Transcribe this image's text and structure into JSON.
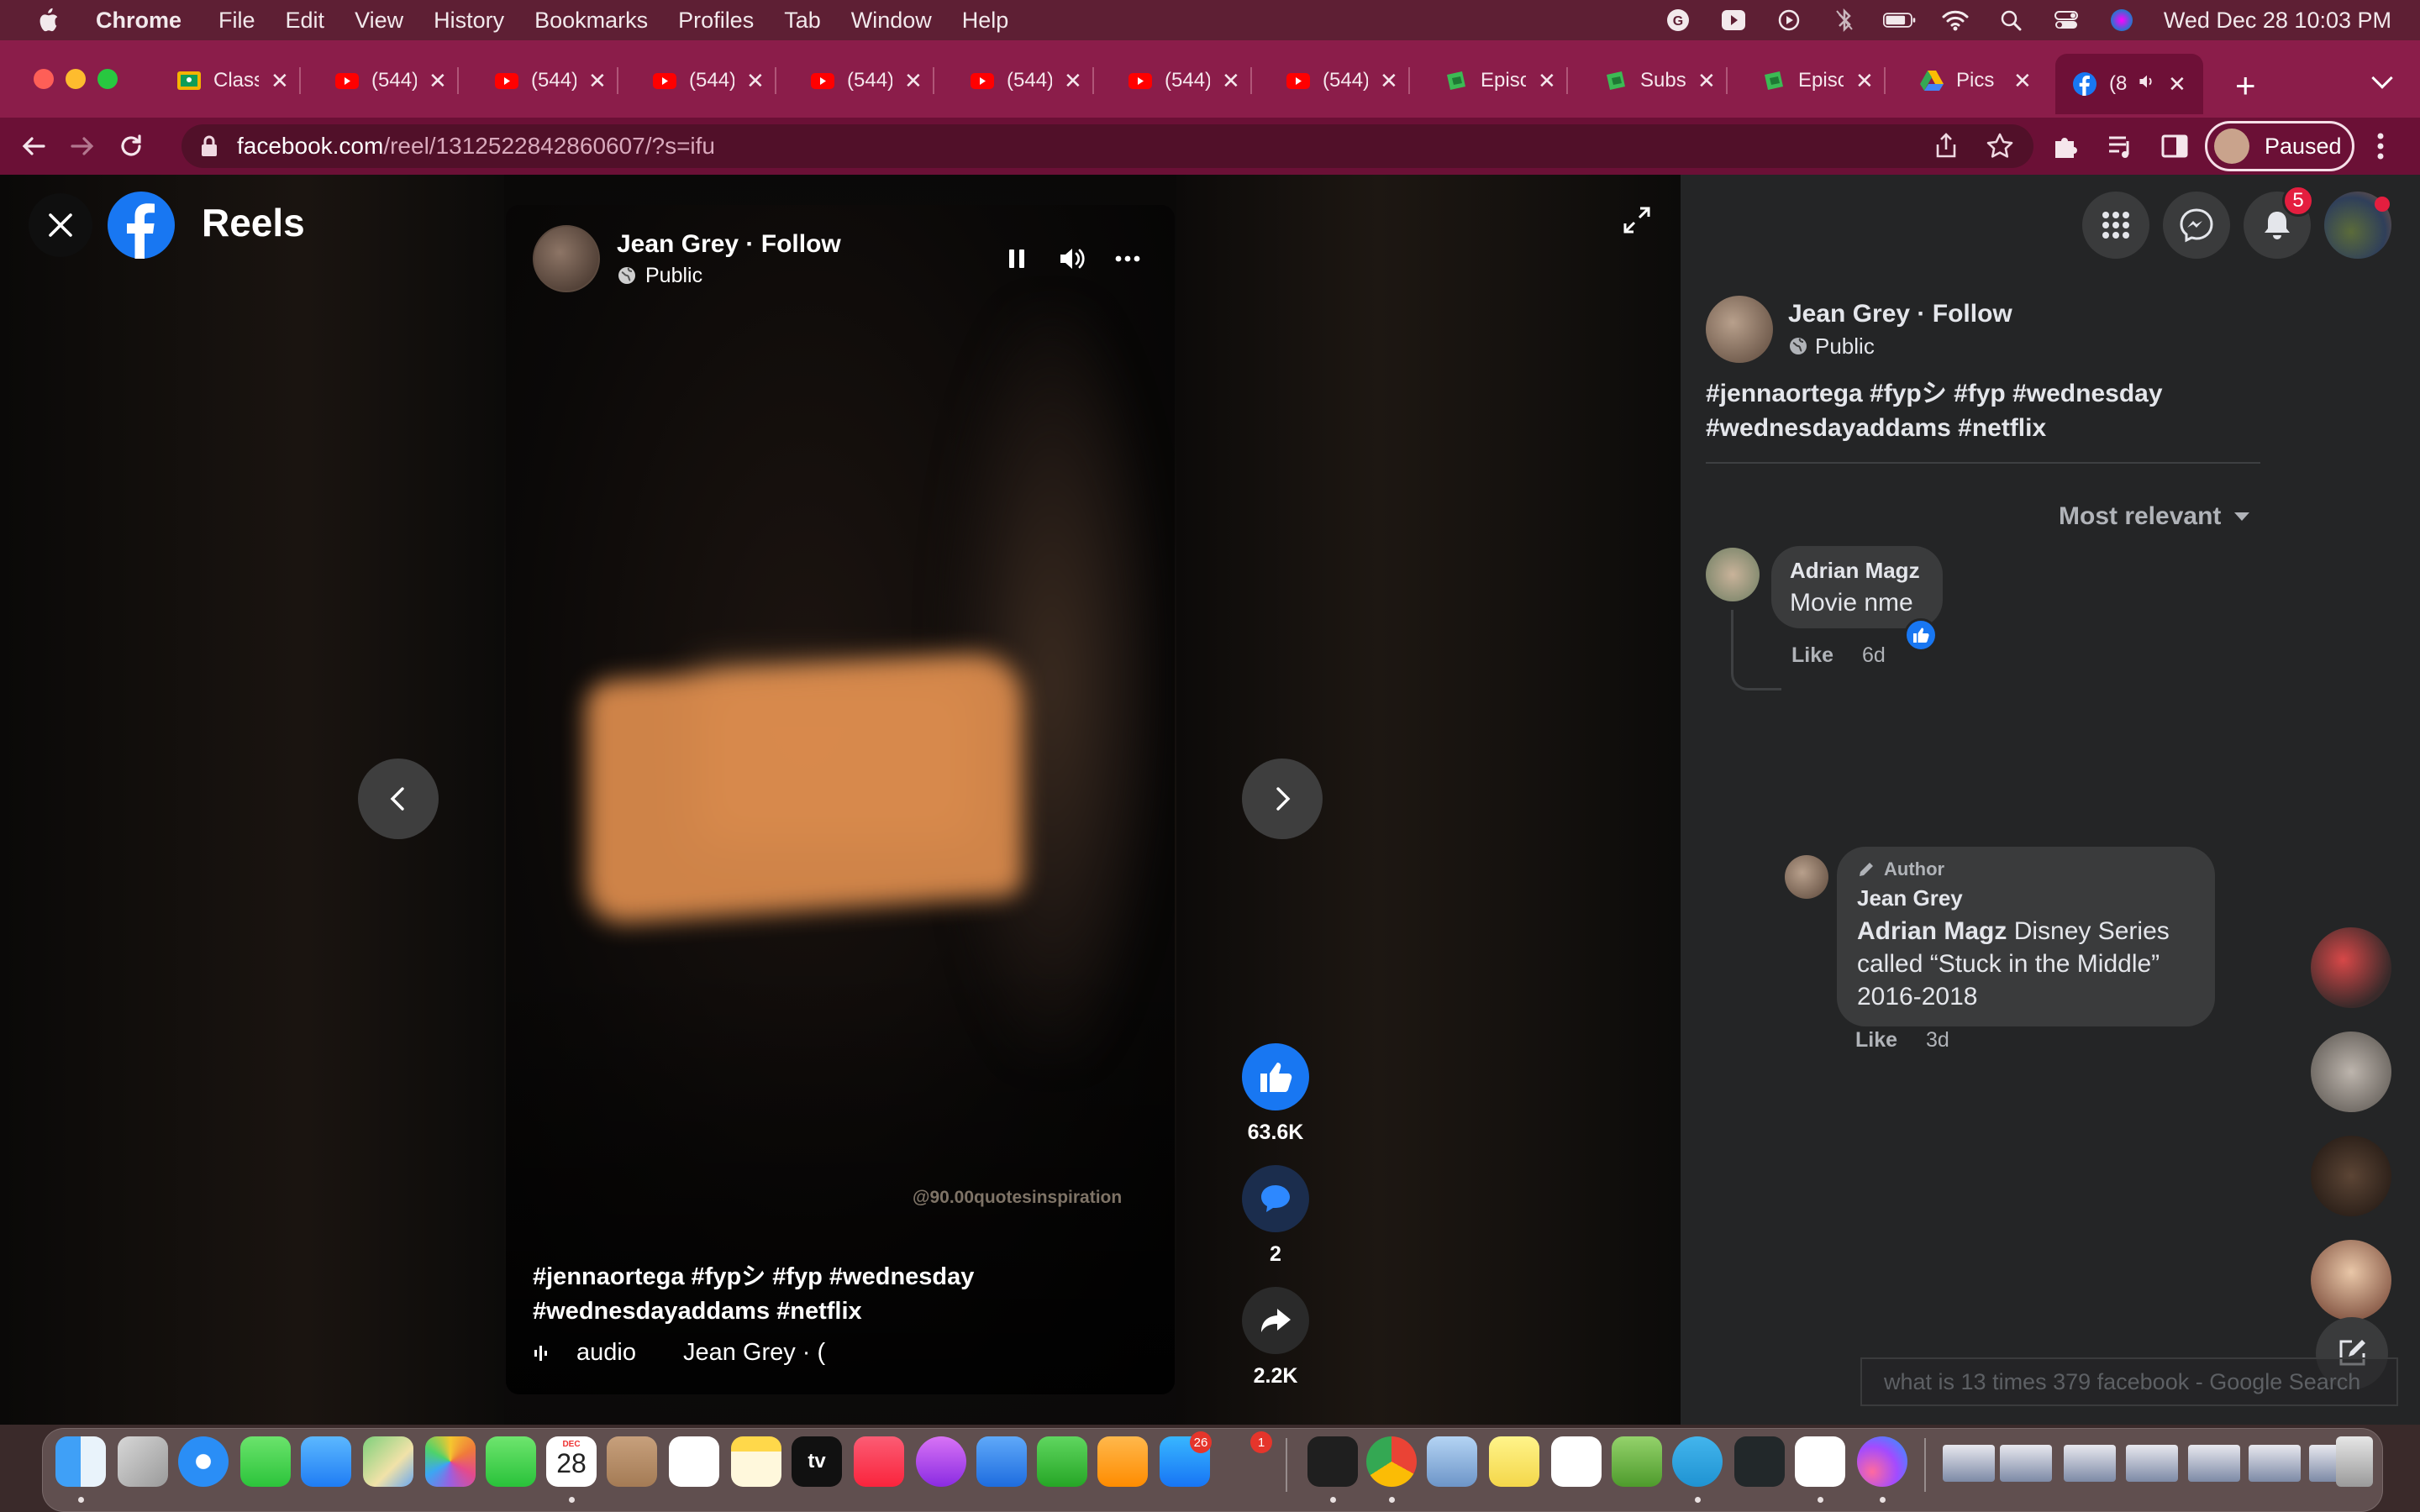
{
  "menubar": {
    "app": "Chrome",
    "items": [
      "File",
      "Edit",
      "View",
      "History",
      "Bookmarks",
      "Profiles",
      "Tab",
      "Window",
      "Help"
    ],
    "clock": "Wed Dec 28  10:03 PM"
  },
  "tabs": [
    {
      "title": "Class",
      "icon": "classroom-icon",
      "color": "#f4b400"
    },
    {
      "title": "(544)",
      "icon": "youtube-icon",
      "color": "#ff0000"
    },
    {
      "title": "(544)",
      "icon": "youtube-icon",
      "color": "#ff0000"
    },
    {
      "title": "(544)",
      "icon": "youtube-icon",
      "color": "#ff0000"
    },
    {
      "title": "(544)",
      "icon": "youtube-icon",
      "color": "#ff0000"
    },
    {
      "title": "(544)",
      "icon": "youtube-icon",
      "color": "#ff0000"
    },
    {
      "title": "(544)",
      "icon": "youtube-icon",
      "color": "#ff0000"
    },
    {
      "title": "(544)",
      "icon": "youtube-icon",
      "color": "#ff0000"
    },
    {
      "title": "Episo",
      "icon": "tv-icon",
      "color": "#3cba54"
    },
    {
      "title": "Subs",
      "icon": "tv-icon",
      "color": "#3cba54"
    },
    {
      "title": "Episo",
      "icon": "tv-icon",
      "color": "#3cba54"
    },
    {
      "title": "Pics",
      "icon": "drive-icon",
      "color": "#4285f4"
    },
    {
      "title": "(8",
      "icon": "facebook-icon",
      "color": "#1877f2"
    }
  ],
  "toolbar": {
    "url_host": "facebook.com",
    "url_path": "/reel/1312522842860607/?s=ifu",
    "profile_label": "Paused"
  },
  "reels": {
    "title": "Reels",
    "video": {
      "author": "Jean Grey · Follow",
      "privacy": "Public",
      "watermark": "@90.00quotesinspiration",
      "caption": "#jennaortega #fypシ #fyp #wednesday #wednesdayaddams #netflix",
      "audio_label": "audio",
      "audio_owner": "Jean Grey · ("
    },
    "actions": {
      "likes": "63.6K",
      "comments": "2",
      "shares": "2.2K"
    }
  },
  "panel": {
    "notifications_count": "5",
    "author": "Jean Grey · Follow",
    "privacy": "Public",
    "caption": "#jennaortega #fypシ #fyp #wednesday #wednesdayaddams #netflix",
    "sort_label": "Most relevant",
    "comments": [
      {
        "name": "Adrian Magz",
        "text": "Movie nme",
        "like_label": "Like",
        "time": "6d"
      },
      {
        "author_tag": "Author",
        "name": "Jean Grey",
        "mention": "Adrian Magz",
        "text": " Disney Series called “Stuck in the Middle” 2016-2018",
        "like_label": "Like",
        "time": "3d"
      }
    ],
    "search_tooltip": "what is 13 times 379 facebook - Google Search"
  },
  "dock": {
    "calendar_month": "DEC",
    "calendar_day": "28",
    "appstore_badge": "26",
    "notes_badge": "1",
    "tv_label": "tv"
  }
}
